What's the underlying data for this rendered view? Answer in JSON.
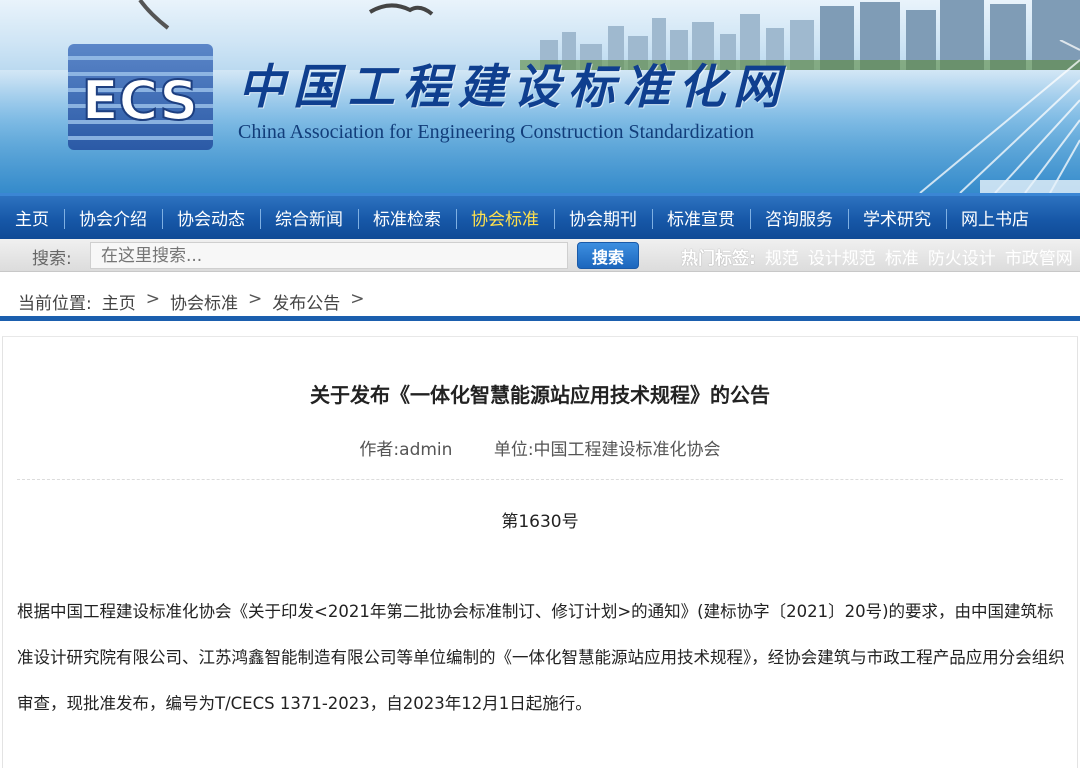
{
  "header": {
    "logo_text": "ECS",
    "site_title": "中国工程建设标准化网",
    "site_subtitle": "China Association for Engineering Construction Standardization"
  },
  "nav": {
    "items": [
      {
        "label": "主页"
      },
      {
        "label": "协会介绍"
      },
      {
        "label": "协会动态"
      },
      {
        "label": "综合新闻"
      },
      {
        "label": "标准检索"
      },
      {
        "label": "协会标准",
        "active": true
      },
      {
        "label": "协会期刊"
      },
      {
        "label": "标准宣贯"
      },
      {
        "label": "咨询服务"
      },
      {
        "label": "学术研究"
      },
      {
        "label": "网上书店"
      }
    ]
  },
  "search": {
    "label": "搜索:",
    "placeholder": "在这里搜索...",
    "button": "搜索",
    "hot_label": "热门标签:",
    "hot_tags": [
      "规范",
      "设计规范",
      "标准",
      "防火设计",
      "市政管网"
    ]
  },
  "breadcrumb": {
    "prefix": "当前位置:",
    "items": [
      "主页",
      "协会标准",
      "发布公告"
    ],
    "separator": ">"
  },
  "article": {
    "title": "关于发布《一体化智慧能源站应用技术规程》的公告",
    "author": "作者:admin",
    "unit": "单位:中国工程建设标准化协会",
    "number": "第1630号",
    "body": "根据中国工程建设标准化协会《关于印发<2021年第二批协会标准制订、修订计划>的通知》(建标协字〔2021〕20号)的要求，由中国建筑标准设计研究院有限公司、江苏鸿鑫智能制造有限公司等单位编制的《一体化智慧能源站应用技术规程》，经协会建筑与市政工程产品应用分会组织审查，现批准发布，编号为T/CECS 1371-2023，自2023年12月1日起施行。"
  },
  "colors": {
    "nav_bg": "#1758a8",
    "nav_active": "#ffe14d",
    "title_blue": "#0f3f8f",
    "rule_blue": "#1b5fae"
  }
}
